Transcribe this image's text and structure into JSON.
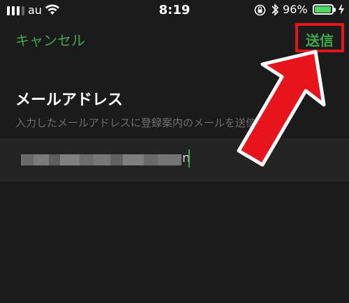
{
  "status_bar": {
    "carrier": "au",
    "time": "8:19",
    "battery_percent": "96%",
    "battery_level": 0.96,
    "bluetooth_glyph": "∗"
  },
  "nav": {
    "cancel_label": "キャンセル",
    "send_label": "送信"
  },
  "section": {
    "title": "メールアドレス",
    "description": "入力したメールアドレスに登録案内のメールを送信"
  },
  "email_field": {
    "visible_tail": "n"
  },
  "colors": {
    "accent_green": "#3ea84a",
    "highlight_red": "#e8141c",
    "background": "#1b1b1b"
  },
  "icons": [
    "signal-icon",
    "wifi-icon",
    "orientation-lock-icon",
    "bluetooth-icon",
    "battery-icon",
    "charging-icon",
    "arrow-icon"
  ]
}
